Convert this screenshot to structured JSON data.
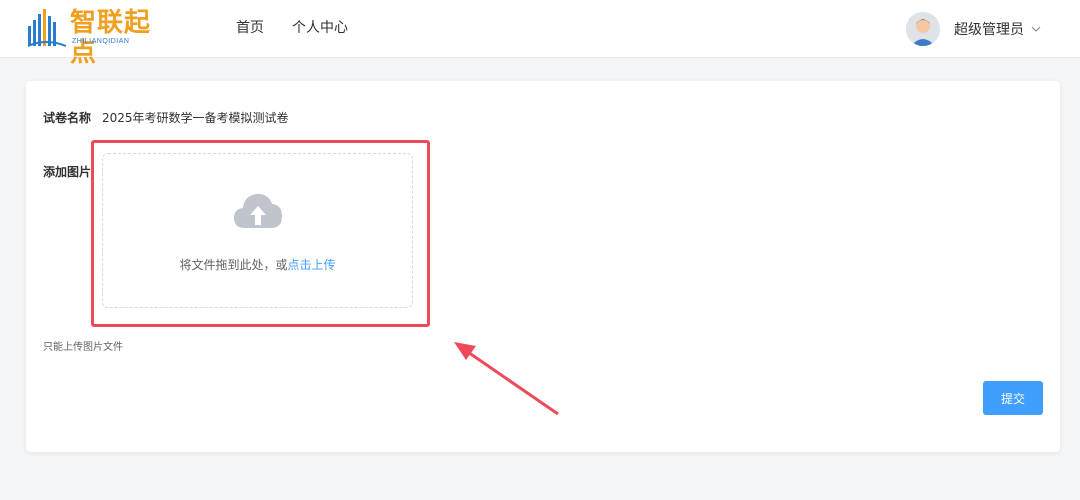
{
  "header": {
    "logo_text": "智联起点",
    "logo_sub": "ZHILIANQIDIAN",
    "nav": [
      "首页",
      "个人中心"
    ],
    "user_name": "超级管理员"
  },
  "form": {
    "paper_label": "试卷名称",
    "paper_value": "2025年考研数学一备考模拟测试卷",
    "image_label": "添加图片",
    "upload_text": "将文件拖到此处，或",
    "upload_link": "点击上传",
    "tip": "只能上传图片文件",
    "submit_label": "提交"
  },
  "colors": {
    "primary": "#409eff",
    "annotation": "#ef4a5a",
    "logo": "#f0a020"
  },
  "icons": [
    "logo-books-icon",
    "chevron-down-icon",
    "cloud-upload-icon",
    "avatar"
  ]
}
